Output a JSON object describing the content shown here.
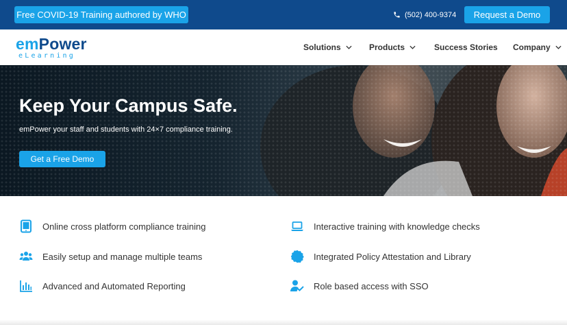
{
  "topbar": {
    "covid_label": "Free COVID-19 Training authored by WHO",
    "phone": "(502) 400-9374",
    "demo_label": "Request a Demo"
  },
  "logo": {
    "main_em": "em",
    "main_power": "Power",
    "sub": "eLearning"
  },
  "nav": [
    {
      "label": "Solutions",
      "dropdown": true
    },
    {
      "label": "Products",
      "dropdown": true
    },
    {
      "label": "Success Stories",
      "dropdown": false
    },
    {
      "label": "Company",
      "dropdown": true
    }
  ],
  "hero": {
    "title": "Keep Your Campus Safe.",
    "subtitle": "emPower your staff and students with 24×7 compliance training.",
    "cta_label": "Get a Free Demo"
  },
  "features": [
    {
      "icon": "tablet-icon",
      "label": "Online cross platform compliance training"
    },
    {
      "icon": "laptop-icon",
      "label": "Interactive training with knowledge checks"
    },
    {
      "icon": "users-icon",
      "label": "Easily setup and manage multiple teams"
    },
    {
      "icon": "certificate-badge-icon",
      "label": "Integrated Policy Attestation and Library"
    },
    {
      "icon": "bar-chart-icon",
      "label": "Advanced and Automated Reporting"
    },
    {
      "icon": "user-check-icon",
      "label": "Role based access with SSO"
    }
  ],
  "colors": {
    "navy": "#0f4a8c",
    "accent": "#1aa3e8",
    "text": "#333333"
  }
}
